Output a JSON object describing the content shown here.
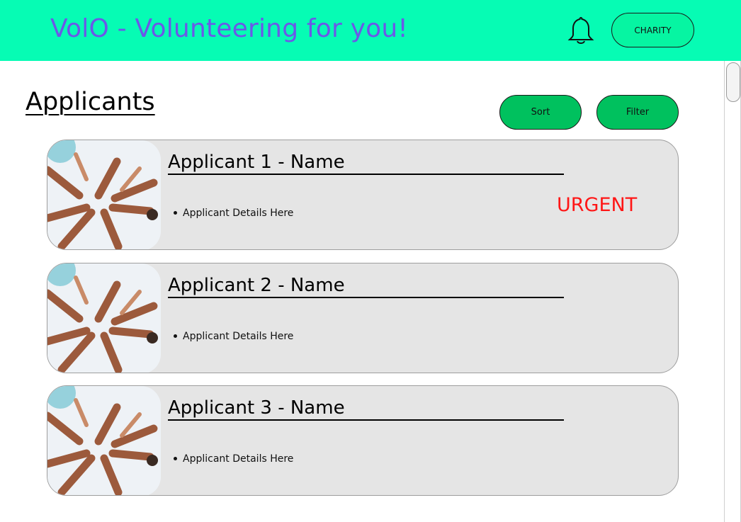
{
  "header": {
    "title": "VolO - Volunteering for you!",
    "bell_icon": "bell-icon",
    "charity_label": "CHARITY",
    "bg_color": "#06fcb4",
    "title_color": "#6b58e8"
  },
  "page": {
    "title": "Applicants",
    "sort_label": "Sort",
    "filter_label": "Filter",
    "button_color": "#00c15e"
  },
  "applicants": [
    {
      "name": "Applicant 1 - Name",
      "detail": "Applicant Details Here",
      "badge": "URGENT",
      "photo_icon": "volunteers-hands-star-image"
    },
    {
      "name": "Applicant 2 - Name",
      "detail": "Applicant Details Here",
      "badge": "",
      "photo_icon": "volunteers-hands-star-image"
    },
    {
      "name": "Applicant 3 - Name",
      "detail": "Applicant Details Here",
      "badge": "",
      "photo_icon": "volunteers-hands-star-image"
    }
  ],
  "colors": {
    "urgent": "#ff1616",
    "card_bg": "#e5e5e5"
  }
}
